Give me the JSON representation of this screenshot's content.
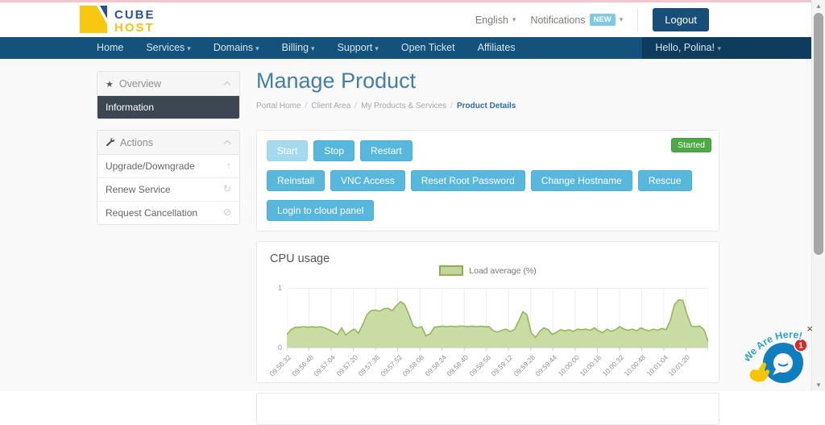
{
  "colors": {
    "navbar": "#14527b",
    "navbar_user_bg": "#0d3c5c",
    "button_blue": "#57b7dd",
    "button_blue_disabled": "#a5d9ee",
    "success_green": "#4cab44",
    "title_blue": "#417fa6",
    "logout_bg": "#174f78",
    "new_badge": "#7fc9e6",
    "chart_fill": "#c9dca3",
    "chart_line": "#94b75c",
    "top_line": "#f2c6cd"
  },
  "header": {
    "logo_line1": "CUBE",
    "logo_line2": "HOST",
    "language": "English",
    "notifications_label": "Notifications",
    "notifications_badge": "NEW",
    "logout_label": "Logout"
  },
  "nav": {
    "items": [
      {
        "label": "Home",
        "dropdown": false
      },
      {
        "label": "Services",
        "dropdown": true
      },
      {
        "label": "Domains",
        "dropdown": true
      },
      {
        "label": "Billing",
        "dropdown": true
      },
      {
        "label": "Support",
        "dropdown": true
      },
      {
        "label": "Open Ticket",
        "dropdown": false
      },
      {
        "label": "Affiliates",
        "dropdown": false
      }
    ],
    "user_label": "Hello, Polina!"
  },
  "sidebar": {
    "overview": {
      "title": "Overview",
      "items": [
        {
          "label": "Information",
          "active": true
        }
      ]
    },
    "actions": {
      "title": "Actions",
      "items": [
        {
          "label": "Upgrade/Downgrade",
          "icon": "arrow-up"
        },
        {
          "label": "Renew Service",
          "icon": "refresh"
        },
        {
          "label": "Request Cancellation",
          "icon": "ban"
        }
      ]
    }
  },
  "main": {
    "title": "Manage Product",
    "breadcrumb": [
      {
        "label": "Portal Home",
        "link": true
      },
      {
        "label": "Client Area",
        "link": true
      },
      {
        "label": "My Products & Services",
        "link": true
      },
      {
        "label": "Product Details",
        "link": false
      }
    ],
    "controls": {
      "status_badge": "Started",
      "row1": [
        {
          "label": "Start",
          "disabled": true
        },
        {
          "label": "Stop",
          "disabled": false
        },
        {
          "label": "Restart",
          "disabled": false
        }
      ],
      "row2": [
        {
          "label": "Reinstall",
          "disabled": false
        },
        {
          "label": "VNC Access",
          "disabled": false
        },
        {
          "label": "Reset Root Password",
          "disabled": false
        },
        {
          "label": "Change Hostname",
          "disabled": false
        },
        {
          "label": "Rescue",
          "disabled": false
        }
      ],
      "row3": [
        {
          "label": "Login to cloud panel",
          "disabled": false
        }
      ]
    }
  },
  "chart_data": {
    "type": "area",
    "title": "CPU usage",
    "legend": "Load average (%)",
    "ylim": [
      0,
      1
    ],
    "y_ticks": [
      "1",
      "0"
    ],
    "grid": true,
    "legend_position": "top-center",
    "x_labels": [
      "09:56:32",
      "09:56:48",
      "09:57:04",
      "09:57:20",
      "09:57:36",
      "09:57:52",
      "09:58:08",
      "09:58:24",
      "09:58:40",
      "09:58:56",
      "09:59:12",
      "09:59:28",
      "09:59:44",
      "10:00:00",
      "10:00:16",
      "10:00:32",
      "10:00:48",
      "10:01:04",
      "10:01:20"
    ],
    "series": [
      {
        "name": "Load average (%)",
        "values": [
          0.22,
          0.3,
          0.34,
          0.34,
          0.35,
          0.34,
          0.35,
          0.34,
          0.35,
          0.33,
          0.3,
          0.26,
          0.22,
          0.33,
          0.21,
          0.27,
          0.31,
          0.24,
          0.38,
          0.55,
          0.62,
          0.63,
          0.61,
          0.65,
          0.66,
          0.62,
          0.7,
          0.77,
          0.72,
          0.55,
          0.36,
          0.33,
          0.35,
          0.2,
          0.23,
          0.34,
          0.35,
          0.36,
          0.35,
          0.36,
          0.35,
          0.36,
          0.36,
          0.35,
          0.36,
          0.35,
          0.36,
          0.35,
          0.35,
          0.28,
          0.26,
          0.29,
          0.31,
          0.27,
          0.3,
          0.44,
          0.6,
          0.55,
          0.25,
          0.17,
          0.27,
          0.33,
          0.3,
          0.22,
          0.26,
          0.3,
          0.28,
          0.3,
          0.27,
          0.31,
          0.3,
          0.31,
          0.29,
          0.33,
          0.28,
          0.25,
          0.31,
          0.27,
          0.3,
          0.35,
          0.31,
          0.29,
          0.31,
          0.28,
          0.33,
          0.3,
          0.28,
          0.31,
          0.29,
          0.32,
          0.3,
          0.45,
          0.72,
          0.8,
          0.79,
          0.55,
          0.36,
          0.35,
          0.36,
          0.3,
          0.1
        ]
      }
    ]
  },
  "chat_widget": {
    "text": "We Are Here!",
    "badge": "1",
    "close": "×"
  }
}
